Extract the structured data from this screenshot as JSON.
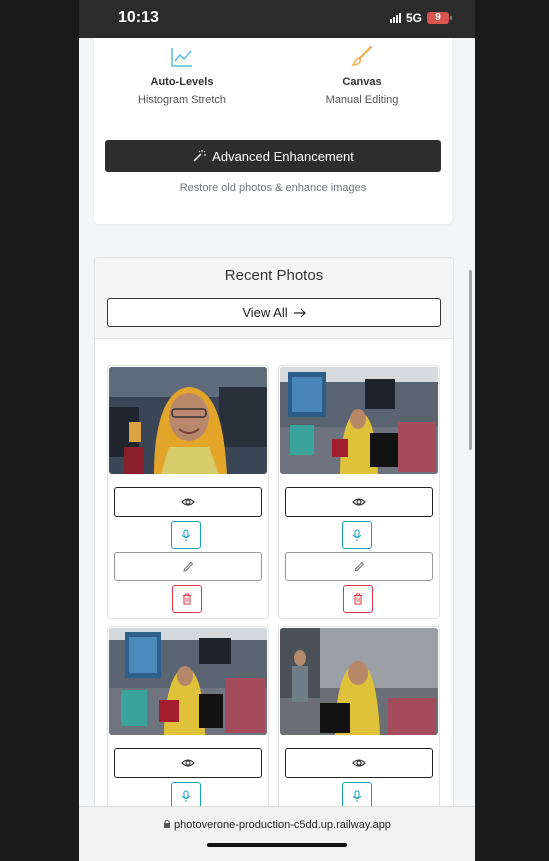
{
  "status_bar": {
    "time": "10:13",
    "network": "5G",
    "battery": "9"
  },
  "tools": [
    {
      "name": "Auto-Levels",
      "desc": "Histogram Stretch",
      "icon": "chart-line-icon"
    },
    {
      "name": "Canvas",
      "desc": "Manual Editing",
      "icon": "brush-icon"
    }
  ],
  "advanced": {
    "label": "Advanced Enhancement",
    "subtitle": "Restore old photos & enhance images"
  },
  "recent": {
    "title": "Recent Photos",
    "view_all": "View All",
    "photos": [
      {
        "subject": "portrait-woman-yellow-hijab"
      },
      {
        "subject": "waiting-room-woman-seated"
      },
      {
        "subject": "waiting-room-woman-bags"
      },
      {
        "subject": "waiting-room-woman-smiling"
      }
    ]
  },
  "colors": {
    "info": "#17a2b8",
    "danger": "#dc3545",
    "dark_button": "#2d2d2d"
  },
  "browser": {
    "url": "photoverone-production-c5dd.up.railway.app"
  }
}
